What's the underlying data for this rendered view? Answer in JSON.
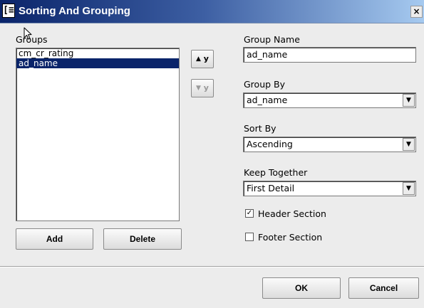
{
  "window": {
    "title": "Sorting And Grouping",
    "close_label": "×"
  },
  "groups": {
    "label": "Groups",
    "items": [
      "cm_cr_rating",
      "ad_name"
    ],
    "selected_index": 1,
    "move_up_label": "y",
    "move_down_label": "y",
    "add_label": "Add",
    "delete_label": "Delete"
  },
  "form": {
    "group_name_label": "Group Name",
    "group_name_value": "ad_name",
    "group_by_label": "Group By",
    "group_by_value": "ad_name",
    "sort_by_label": "Sort By",
    "sort_by_value": "Ascending",
    "keep_together_label": "Keep Together",
    "keep_together_value": "First Detail",
    "header_section_label": "Header Section",
    "header_section_checked": true,
    "footer_section_label": "Footer Section",
    "footer_section_checked": false
  },
  "footer": {
    "ok_label": "OK",
    "cancel_label": "Cancel"
  },
  "icons": {
    "app": "window-app-icon",
    "close": "close-icon",
    "up": "arrow-up-icon",
    "down": "arrow-down-icon",
    "dropdown": "chevron-down-icon",
    "cursor": "mouse-cursor-icon"
  },
  "colors": {
    "title_start": "#0a246a",
    "title_end": "#a6caf0",
    "selection": "#0a246a",
    "dialog_bg": "#ececec"
  }
}
